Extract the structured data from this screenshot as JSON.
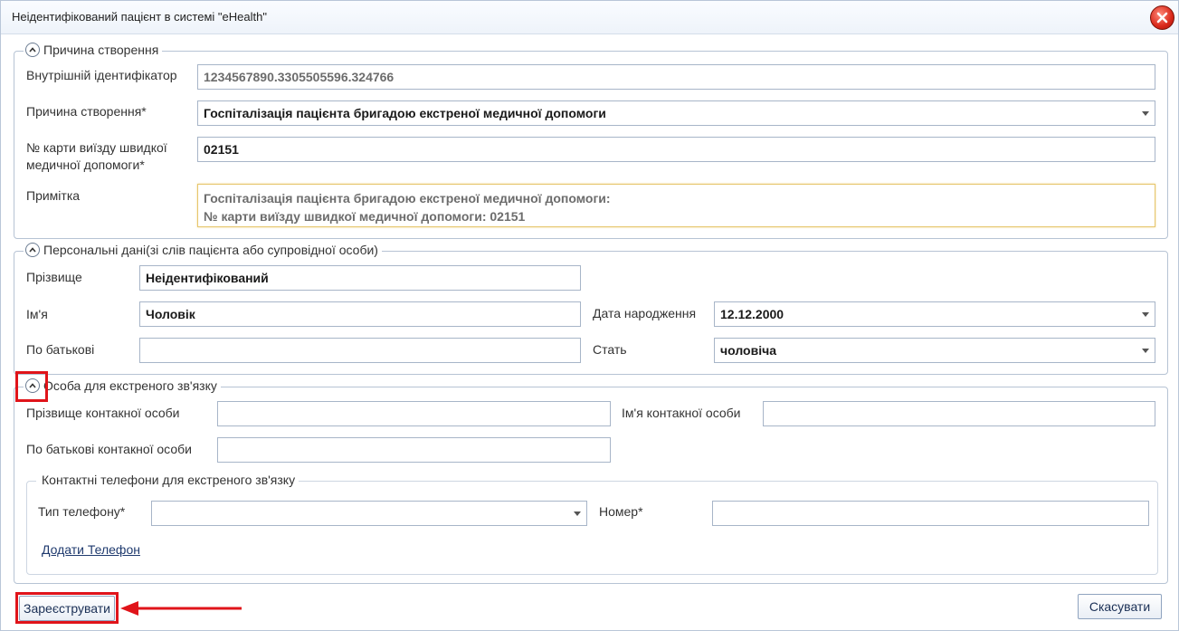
{
  "window": {
    "title": "Неідентифікований пацієнт в системі \"eHealth\""
  },
  "section_reason": {
    "title": "Причина створення",
    "internal_id_label": "Внутрішній ідентифікатор",
    "internal_id_value": "1234567890.3305505596.324766",
    "reason_label": "Причина створення*",
    "reason_value": "Госпіталізація пацієнта бригадою екстреної медичної допомоги",
    "card_label_1": "№ карти виїзду швидкої",
    "card_label_2": "медичної допомоги*",
    "card_value": "02151",
    "note_label": "Примітка",
    "note_line_1": "Госпіталізація пацієнта бригадою екстреної медичної допомоги:",
    "note_line_2": "№ карти виїзду швидкої медичної допомоги: 02151"
  },
  "section_personal": {
    "title": "Персональні дані(зі слів пацієнта або супровідної особи)",
    "surname_label": "Прізвище",
    "surname_value": "Неідентифікований",
    "name_label": "Ім'я",
    "name_value": "Чоловік",
    "birth_label": "Дата народження",
    "birth_value": "12.12.2000",
    "patronymic_label": "По батькові",
    "patronymic_value": "",
    "sex_label": "Стать",
    "sex_value": "чоловіча"
  },
  "section_contact": {
    "title": "Особа для екстреного зв'язку",
    "contact_surname_label": "Прізвище контакної особи",
    "contact_name_label": "Ім'я контакної особи",
    "contact_patronymic_label": "По батькові контакної особи",
    "phones": {
      "title": "Контактні телефони для екстреного зв'язку",
      "phone_type_label": "Тип телефону*",
      "phone_type_value": "",
      "number_label": "Номер*",
      "number_value": "",
      "add_phone_link": "Додати Телефон"
    }
  },
  "footer": {
    "register_label": "Зареєструвати",
    "cancel_label": "Скасувати"
  },
  "colors": {
    "highlight": "#e0141a",
    "border": "#b6c3d4"
  }
}
